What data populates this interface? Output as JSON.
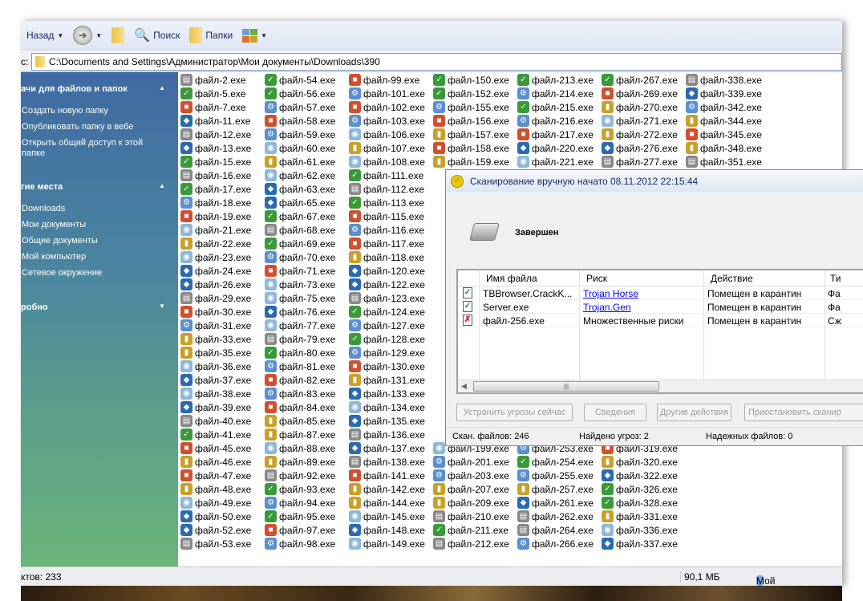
{
  "toolbar": {
    "back": "Назад",
    "search": "Поиск",
    "folders": "Папки"
  },
  "address": {
    "label": "с:",
    "path": "C:\\Documents and Settings\\Администратор\\Мои документы\\Downloads\\390"
  },
  "sidebar": {
    "tasks_title": "ачи для файлов и папок",
    "tasks": [
      "Создать новую папку",
      "Опубликовать папку в вебе",
      "Открыть общий доступ к этой папке"
    ],
    "places_title": "гие места",
    "places": [
      "Downloads",
      "Мои документы",
      "Общие документы",
      "Мой компьютер",
      "Сетевое окружение"
    ],
    "details_title": "робно"
  },
  "files": {
    "columns": [
      {
        "top": [
          "файл-2.exe",
          "файл-5.exe",
          "файл-7.exe",
          "файл-11.exe",
          "файл-12.exe",
          "файл-13.exe",
          "файл-15.exe",
          "файл-16.exe",
          "файл-17.exe",
          "файл-18.exe",
          "файл-19.exe",
          "файл-21.exe",
          "файл-22.exe",
          "файл-23.exe",
          "файл-24.exe",
          "файл-26.exe",
          "файл-29.exe",
          "файл-30.exe",
          "файл-31.exe",
          "файл-33.exe",
          "файл-35.exe",
          "файл-36.exe",
          "файл-37.exe",
          "файл-38.exe",
          "файл-39.exe",
          "файл-40.exe",
          "файл-41.exe",
          "файл-45.exe",
          "файл-46.exe",
          "файл-47.exe",
          "файл-48.exe",
          "файл-49.exe",
          "файл-50.exe",
          "файл-52.exe",
          "файл-53.exe"
        ],
        "bottom": []
      },
      {
        "top": [
          "файл-54.exe",
          "файл-56.exe",
          "файл-57.exe",
          "файл-58.exe",
          "файл-59.exe",
          "файл-60.exe",
          "файл-61.exe",
          "файл-62.exe",
          "файл-63.exe",
          "файл-65.exe",
          "файл-67.exe",
          "файл-68.exe",
          "файл-69.exe",
          "файл-70.exe",
          "файл-71.exe",
          "файл-73.exe",
          "файл-75.exe",
          "файл-76.exe",
          "файл-77.exe",
          "файл-79.exe",
          "файл-80.exe",
          "файл-81.exe",
          "файл-82.exe",
          "файл-83.exe",
          "файл-84.exe",
          "файл-85.exe",
          "файл-87.exe",
          "файл-88.exe",
          "файл-89.exe",
          "файл-92.exe",
          "файл-93.exe",
          "файл-94.exe",
          "файл-95.exe",
          "файл-97.exe",
          "файл-98.exe"
        ],
        "bottom": []
      },
      {
        "top": [
          "файл-99.exe",
          "файл-101.exe",
          "файл-102.exe",
          "файл-103.exe",
          "файл-106.exe",
          "файл-107.exe",
          "файл-108.exe",
          "файл-111.exe",
          "файл-112.exe",
          "файл-113.exe",
          "файл-115.exe",
          "файл-116.exe",
          "файл-117.exe",
          "файл-118.exe",
          "файл-120.exe",
          "файл-122.exe",
          "файл-123.exe",
          "файл-124.exe",
          "файл-127.exe",
          "файл-128.exe",
          "файл-129.exe",
          "файл-130.exe",
          "файл-131.exe",
          "файл-133.exe",
          "файл-134.exe",
          "файл-135.exe",
          "файл-136.exe",
          "файл-137.exe",
          "файл-138.exe",
          "файл-141.exe",
          "файл-142.exe",
          "файл-144.exe",
          "файл-145.exe",
          "файл-148.exe",
          "файл-149.exe"
        ],
        "bottom": []
      },
      {
        "top": [
          "файл-150.exe",
          "файл-152.exe",
          "файл-155.exe",
          "файл-156.exe",
          "файл-157.exe",
          "файл-158.exe",
          "файл-159.exe"
        ],
        "bottom": [
          "файл-199.exe",
          "файл-201.exe",
          "файл-203.exe",
          "файл-207.exe",
          "файл-209.exe",
          "файл-210.exe",
          "файл-211.exe",
          "файл-212.exe"
        ]
      },
      {
        "top": [
          "файл-213.exe",
          "файл-214.exe",
          "файл-215.exe",
          "файл-216.exe",
          "файл-217.exe",
          "файл-220.exe",
          "файл-221.exe"
        ],
        "bottom": [
          "файл-253.exe",
          "файл-254.exe",
          "файл-255.exe",
          "файл-257.exe",
          "файл-261.exe",
          "файл-262.exe",
          "файл-264.exe",
          "файл-266.exe"
        ]
      },
      {
        "top": [
          "файл-267.exe",
          "файл-269.exe",
          "файл-270.exe",
          "файл-271.exe",
          "файл-272.exe",
          "файл-276.exe",
          "файл-277.exe"
        ],
        "bottom": [
          "файл-319.exe",
          "файл-320.exe",
          "файл-322.exe",
          "файл-326.exe",
          "файл-328.exe",
          "файл-331.exe",
          "файл-336.exe",
          "файл-337.exe"
        ]
      },
      {
        "top": [
          "файл-338.exe",
          "файл-339.exe",
          "файл-342.exe",
          "файл-344.exe",
          "файл-345.exe",
          "файл-348.exe",
          "файл-351.exe"
        ],
        "bottom": []
      }
    ]
  },
  "status": {
    "objects": "ктов: 233",
    "size": "90,1 МБ",
    "location": "Мой компьютер"
  },
  "dialog": {
    "title": "Сканирование вручную начато 08.11.2012 22:15:44",
    "state": "Завершен",
    "headers": [
      "Имя файла",
      "Риск",
      "Действие",
      "Ти"
    ],
    "rows": [
      {
        "status": "ok",
        "name": "TBBrowser.CrackK...",
        "risk": "Trojan Horse",
        "risk_link": true,
        "action": "Помещен в карантин",
        "type": "Фа"
      },
      {
        "status": "ok",
        "name": "Server.exe",
        "risk": "Trojan.Gen",
        "risk_link": true,
        "action": "Помещен в карантин",
        "type": "Фа"
      },
      {
        "status": "fail",
        "name": "файл-256.exe",
        "risk": "Множественные риски",
        "risk_link": false,
        "action": "Помещен в карантин",
        "type": "Сж"
      }
    ],
    "buttons": [
      "Устранить угрозы сейчас",
      "Сведения",
      "Другие действия",
      "Приостановить сканир"
    ],
    "stats": {
      "scanned": "Скан. файлов: 246",
      "threats": "Найдено угроз: 2",
      "trusted": "Надежных файлов: 0"
    }
  }
}
